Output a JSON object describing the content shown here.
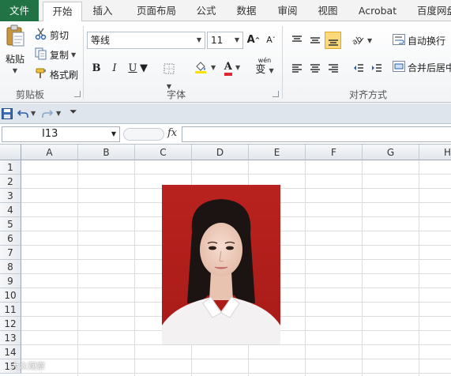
{
  "ribbon_tabs": [
    {
      "label": "文件"
    },
    {
      "label": "开始"
    },
    {
      "label": "插入"
    },
    {
      "label": "页面布局"
    },
    {
      "label": "公式"
    },
    {
      "label": "数据"
    },
    {
      "label": "审阅"
    },
    {
      "label": "视图"
    },
    {
      "label": "Acrobat"
    },
    {
      "label": "百度网盘"
    }
  ],
  "clipboard": {
    "paste_label": "粘贴",
    "cut_label": "剪切",
    "copy_label": "复制",
    "format_painter_label": "格式刷",
    "group_label": "剪贴板"
  },
  "font": {
    "name": "等线",
    "size": "11",
    "bold": "B",
    "italic": "I",
    "underline": "U",
    "font_color_letter": "A",
    "phonetic": "wén",
    "phonetic_char": "变",
    "grow_letter": "A",
    "shrink_letter": "A",
    "group_label": "字体"
  },
  "alignment": {
    "wrap_text_label": "自动换行",
    "merge_center_label": "合并后居中",
    "group_label": "对齐方式"
  },
  "formula_bar": {
    "name_box": "I13",
    "fx_label": "fx",
    "formula": ""
  },
  "sheet": {
    "columns": [
      "A",
      "B",
      "C",
      "D",
      "E",
      "F",
      "G",
      "H"
    ],
    "rows": [
      "1",
      "2",
      "3",
      "4",
      "5",
      "6",
      "7",
      "8",
      "9",
      "10",
      "11",
      "12",
      "13",
      "14",
      "15"
    ]
  },
  "photo": {
    "subject": "证件照 - 红底",
    "background_color": "#b5211d",
    "shirt_color": "#f3f1f2"
  },
  "watermark": "大众观察",
  "colors": {
    "file_tab": "#217346",
    "ribbon_group_label": "#555555",
    "font_color_bar": "#e0262f",
    "highlight_color_bar": "#f7e200"
  }
}
